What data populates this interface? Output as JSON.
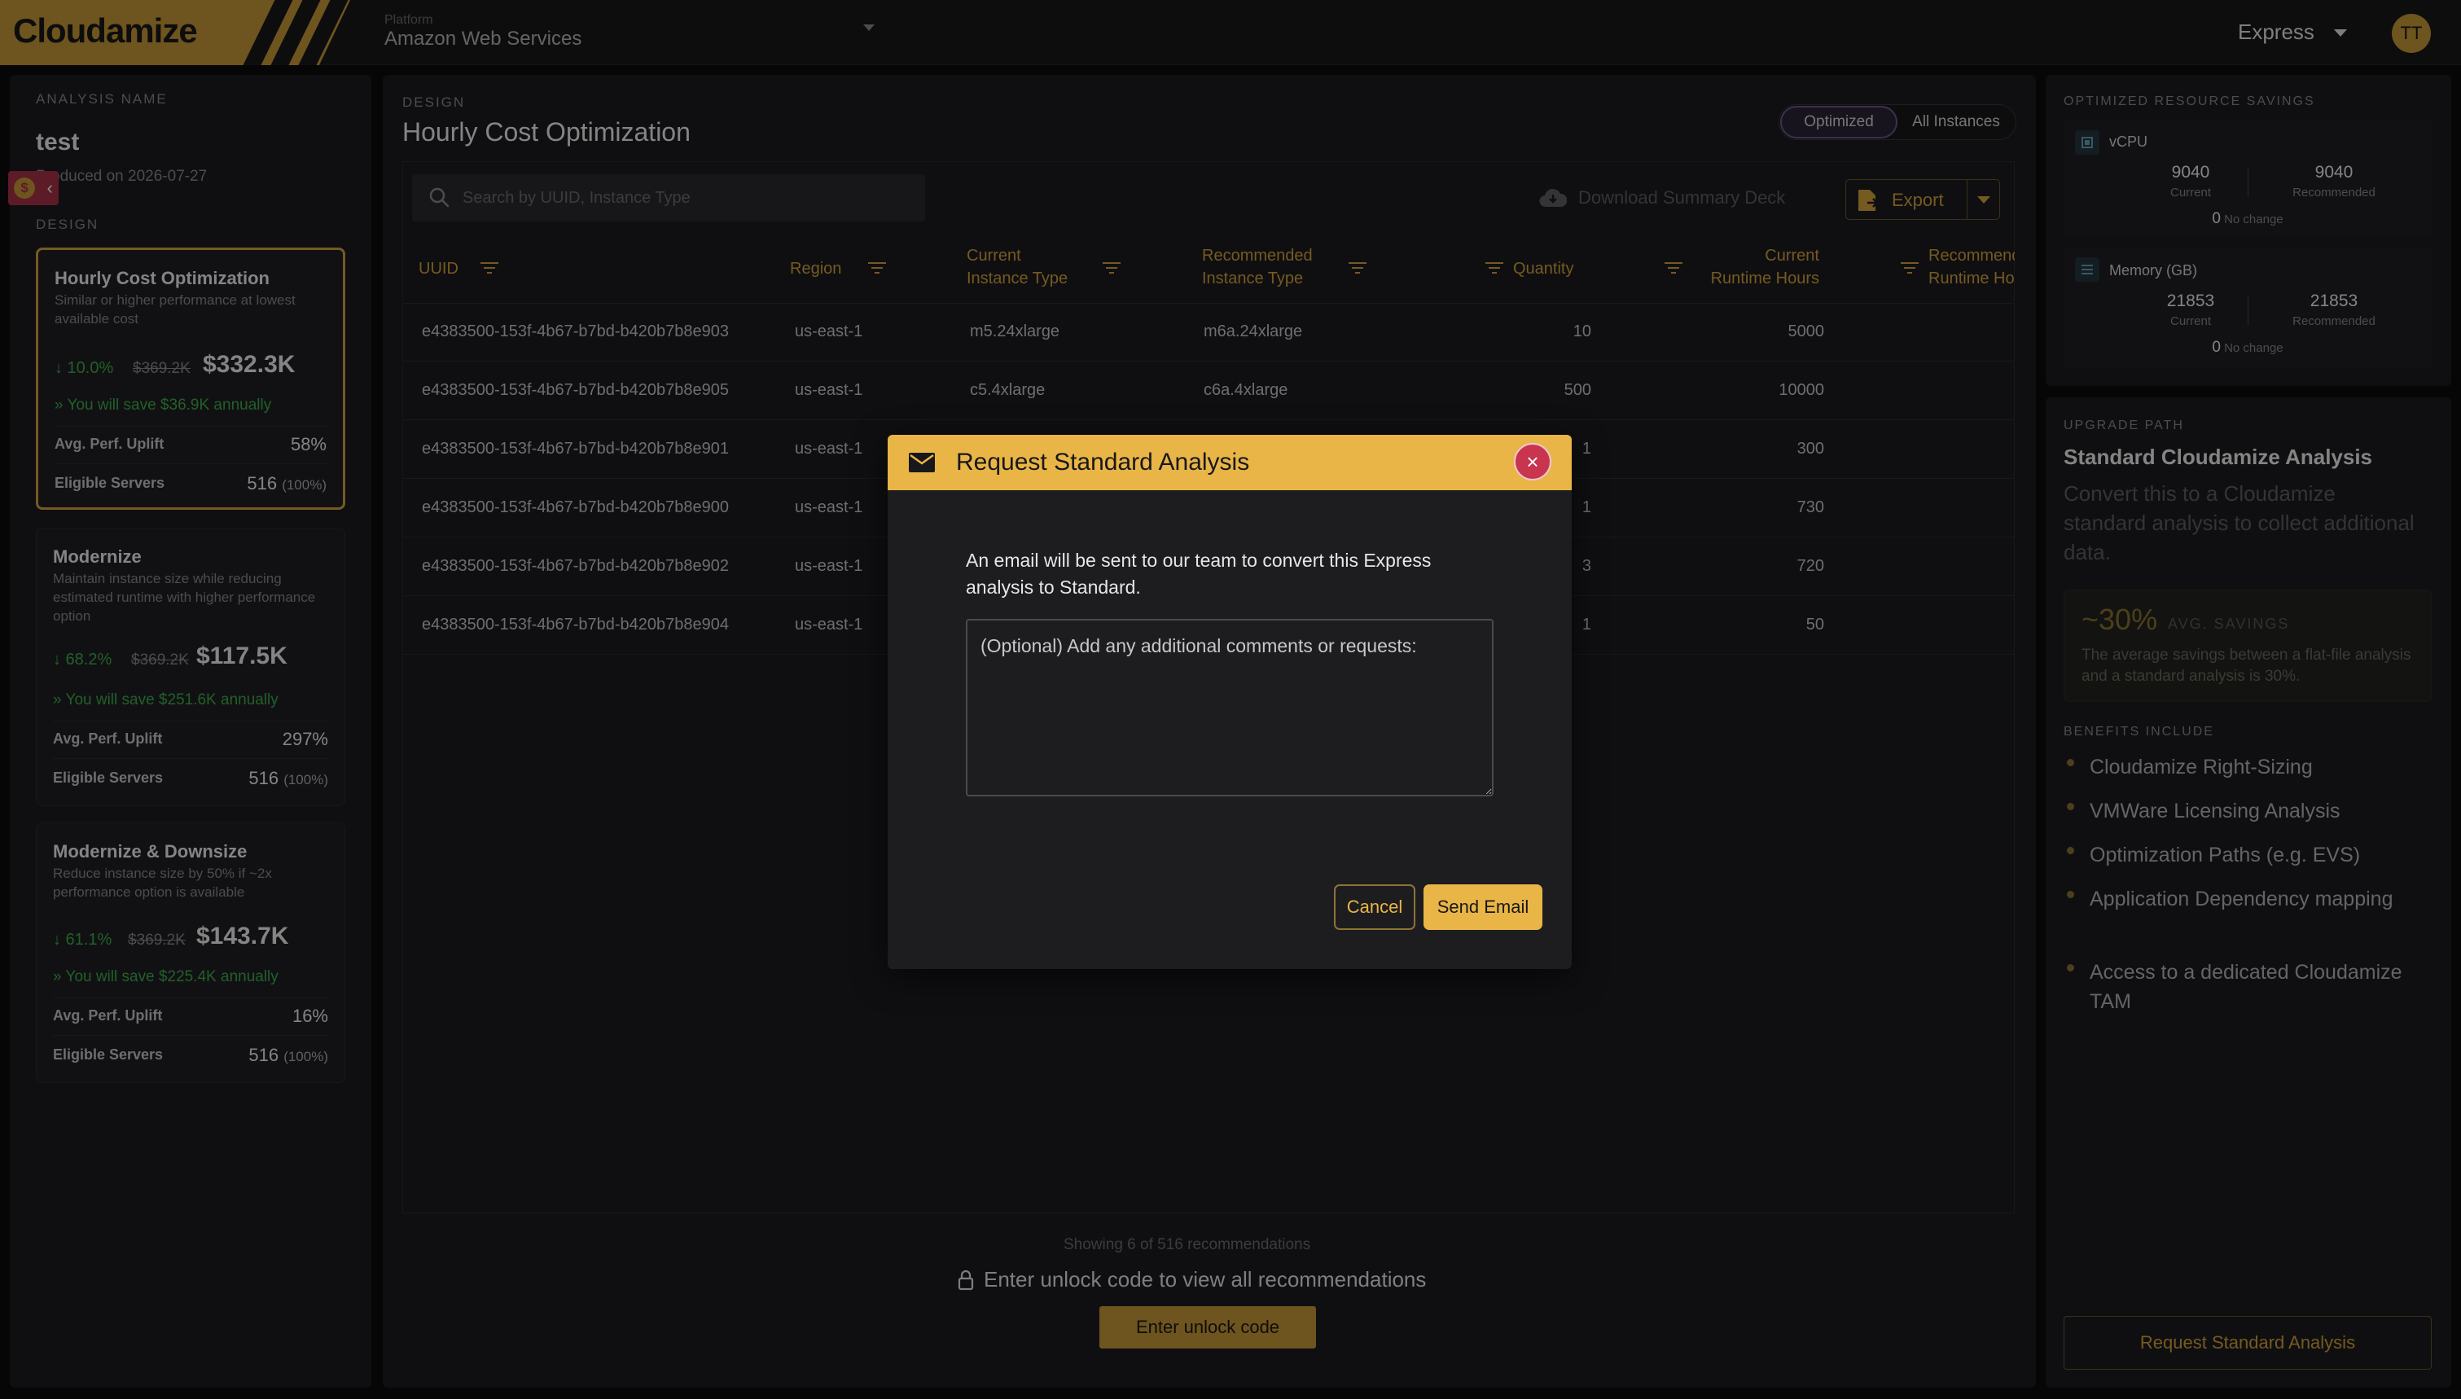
{
  "topbar": {
    "logo": "Cloudamize",
    "platform_label": "Platform",
    "platform_value": "Amazon Web Services",
    "plan": "Express",
    "avatar_initials": "TT"
  },
  "left": {
    "analysis_label": "ANALYSIS NAME",
    "analysis_name": "test",
    "produced": "Produced on 2026-07-27",
    "design_label": "DESIGN",
    "cards": [
      {
        "title": "Hourly Cost Optimization",
        "desc": "Similar or higher performance at lowest available cost",
        "pct": "↓ 10.0%",
        "orig": "$369.2K",
        "new": "$332.3K",
        "savings": "You will save $36.9K annually",
        "perf_label": "Avg. Perf. Uplift",
        "perf_val": "58%",
        "servers_label": "Eligible Servers",
        "servers_val": "516",
        "servers_pct": "(100%)"
      },
      {
        "title": "Modernize",
        "desc": "Maintain instance size while reducing estimated runtime with higher performance option",
        "pct": "↓ 68.2%",
        "orig": "$369.2K",
        "new": "$117.5K",
        "savings": "You will save $251.6K annually",
        "perf_label": "Avg. Perf. Uplift",
        "perf_val": "297%",
        "servers_label": "Eligible Servers",
        "servers_val": "516",
        "servers_pct": "(100%)"
      },
      {
        "title": "Modernize & Downsize",
        "desc": "Reduce instance size by 50% if ~2x performance option is available",
        "pct": "↓ 61.1%",
        "orig": "$369.2K",
        "new": "$143.7K",
        "savings": "You will save $225.4K annually",
        "perf_label": "Avg. Perf. Uplift",
        "perf_val": "16%",
        "servers_label": "Eligible Servers",
        "servers_val": "516",
        "servers_pct": "(100%)"
      }
    ]
  },
  "main": {
    "design_label": "DESIGN",
    "title": "Hourly Cost Optimization",
    "toggle_optimized": "Optimized",
    "toggle_all": "All Instances",
    "search_placeholder": "Search by UUID, Instance Type",
    "download_deck": "Download Summary Deck",
    "export": "Export",
    "columns": {
      "uuid": "UUID",
      "region": "Region",
      "current_type_1": "Current",
      "current_type_2": "Instance Type",
      "rec_type_1": "Recommended",
      "rec_type_2": "Instance Type",
      "quantity": "Quantity",
      "cur_runtime_1": "Current",
      "cur_runtime_2": "Runtime Hours",
      "rec_runtime_1": "Recommended",
      "rec_runtime_2": "Runtime Hours"
    },
    "rows": [
      {
        "uuid": "e4383500-153f-4b67-b7bd-b420b7b8e903",
        "region": "us-east-1",
        "cur": "m5.24xlarge",
        "rec": "m6a.24xlarge",
        "qty": "10",
        "hours": "5000"
      },
      {
        "uuid": "e4383500-153f-4b67-b7bd-b420b7b8e905",
        "region": "us-east-1",
        "cur": "c5.4xlarge",
        "rec": "c6a.4xlarge",
        "qty": "500",
        "hours": "10000"
      },
      {
        "uuid": "e4383500-153f-4b67-b7bd-b420b7b8e901",
        "region": "us-east-1",
        "cur": "",
        "rec": "",
        "qty": "1",
        "hours": "300"
      },
      {
        "uuid": "e4383500-153f-4b67-b7bd-b420b7b8e900",
        "region": "us-east-1",
        "cur": "",
        "rec": "",
        "qty": "1",
        "hours": "730"
      },
      {
        "uuid": "e4383500-153f-4b67-b7bd-b420b7b8e902",
        "region": "us-east-1",
        "cur": "",
        "rec": "",
        "qty": "3",
        "hours": "720"
      },
      {
        "uuid": "e4383500-153f-4b67-b7bd-b420b7b8e904",
        "region": "us-east-1",
        "cur": "",
        "rec": "",
        "qty": "1",
        "hours": "50"
      }
    ],
    "showing": "Showing 6 of 516 recommendations",
    "unlock_text": "Enter unlock code to view all recommendations",
    "unlock_button": "Enter unlock code"
  },
  "right": {
    "ors_label": "OPTIMIZED RESOURCE SAVINGS",
    "vcpu": {
      "title": "vCPU",
      "current": "9040",
      "current_label": "Current",
      "recommended": "9040",
      "recommended_label": "Recommended",
      "change": "0",
      "change_label": "No change"
    },
    "memory": {
      "title": "Memory (GB)",
      "current": "21853",
      "current_label": "Current",
      "recommended": "21853",
      "recommended_label": "Recommended",
      "change": "0",
      "change_label": "No change"
    },
    "upgrade_label": "UPGRADE PATH",
    "upgrade_title": "Standard Cloudamize Analysis",
    "upgrade_desc": "Convert this to a Cloudamize standard analysis to collect additional data.",
    "savings_pct": "~30%",
    "savings_avg": "AVG. SAVINGS",
    "savings_desc": "The average savings between a flat-file analysis and a standard analysis is 30%.",
    "benefits_label": "BENEFITS INCLUDE",
    "benefits": [
      "Cloudamize Right-Sizing",
      "VMWare Licensing Analysis",
      "Optimization Paths (e.g. EVS)",
      "Application Dependency mapping",
      "Access to a dedicated Cloudamize TAM"
    ],
    "request_button": "Request Standard Analysis"
  },
  "modal": {
    "title": "Request Standard Analysis",
    "message": "An email will be sent to our team to convert this Express analysis to Standard.",
    "placeholder": "(Optional) Add any additional comments or requests:",
    "cancel": "Cancel",
    "send": "Send Email"
  }
}
